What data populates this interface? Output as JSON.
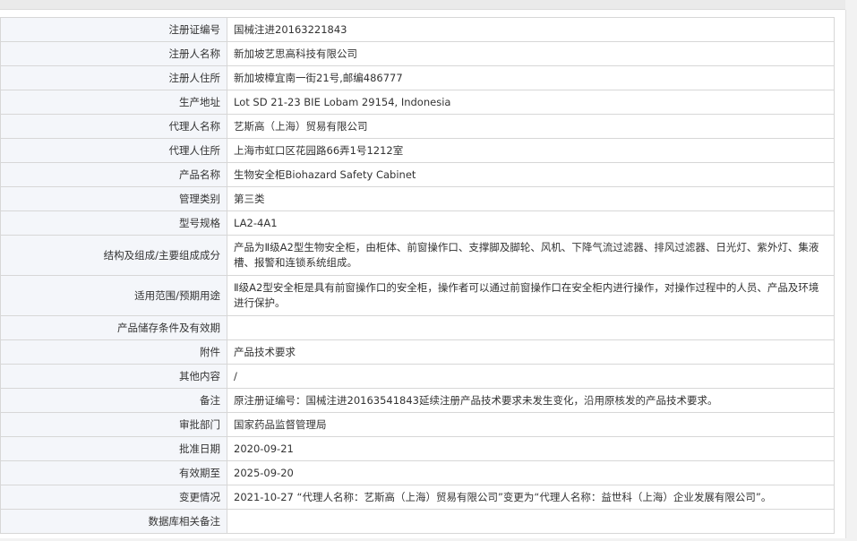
{
  "rows": [
    {
      "label": "注册证编号",
      "value": "国械注进20163221843"
    },
    {
      "label": "注册人名称",
      "value": "新加坡艺思高科技有限公司"
    },
    {
      "label": "注册人住所",
      "value": "新加坡樟宜南一街21号,邮编486777"
    },
    {
      "label": "生产地址",
      "value": "Lot SD 21-23 BIE Lobam 29154, Indonesia"
    },
    {
      "label": "代理人名称",
      "value": "艺斯高（上海）贸易有限公司"
    },
    {
      "label": "代理人住所",
      "value": "上海市虹口区花园路66弄1号1212室"
    },
    {
      "label": "产品名称",
      "value": "生物安全柜Biohazard Safety Cabinet"
    },
    {
      "label": "管理类别",
      "value": "第三类"
    },
    {
      "label": "型号规格",
      "value": "LA2-4A1"
    },
    {
      "label": "结构及组成/主要组成成分",
      "value": "产品为Ⅱ级A2型生物安全柜，由柜体、前窗操作口、支撑脚及脚轮、风机、下降气流过滤器、排风过滤器、日光灯、紫外灯、集液槽、报警和连锁系统组成。"
    },
    {
      "label": "适用范围/预期用途",
      "value": "Ⅱ级A2型安全柜是具有前窗操作口的安全柜，操作者可以通过前窗操作口在安全柜内进行操作，对操作过程中的人员、产品及环境进行保护。"
    },
    {
      "label": "产品储存条件及有效期",
      "value": ""
    },
    {
      "label": "附件",
      "value": "产品技术要求"
    },
    {
      "label": "其他内容",
      "value": "/"
    },
    {
      "label": "备注",
      "value": "原注册证编号：国械注进20163541843延续注册产品技术要求未发生变化，沿用原核发的产品技术要求。"
    },
    {
      "label": "审批部门",
      "value": "国家药品监督管理局"
    },
    {
      "label": "批准日期",
      "value": "2020-09-21"
    },
    {
      "label": "有效期至",
      "value": "2025-09-20"
    },
    {
      "label": "变更情况",
      "value": "2021-10-27 “代理人名称：艺斯高（上海）贸易有限公司”变更为“代理人名称：益世科（上海）企业发展有限公司”。"
    },
    {
      "label": "数据库相关备注",
      "value": ""
    }
  ]
}
